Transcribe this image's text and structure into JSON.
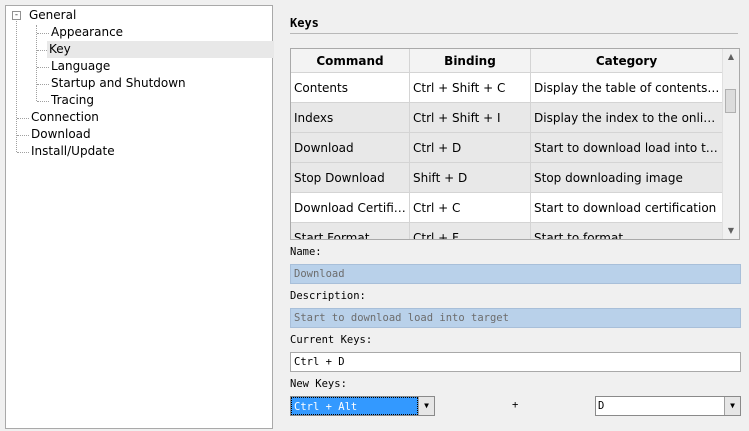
{
  "tree": {
    "items": [
      {
        "label": "General",
        "level": 0,
        "expanded": true
      },
      {
        "label": "Appearance",
        "level": 1
      },
      {
        "label": "Key",
        "level": 1,
        "selected": true
      },
      {
        "label": "Language",
        "level": 1
      },
      {
        "label": "Startup and Shutdown",
        "level": 1
      },
      {
        "label": "Tracing",
        "level": 1
      },
      {
        "label": "Connection",
        "level": 0
      },
      {
        "label": "Download",
        "level": 0
      },
      {
        "label": "Install/Update",
        "level": 0
      }
    ],
    "expander_symbol": "-"
  },
  "section": {
    "title": "Keys"
  },
  "grid": {
    "columns": [
      "Command",
      "Binding",
      "Category"
    ],
    "rows": [
      [
        "Contents",
        "Ctrl + Shift + C",
        "Display the table of contents for help"
      ],
      [
        "Indexs",
        "Ctrl + Shift + I",
        "Display the index to the online help"
      ],
      [
        "Download",
        "Ctrl + D",
        "Start to download load into target"
      ],
      [
        "Stop Download",
        "Shift + D",
        "Stop downloading image"
      ],
      [
        "Download Certification",
        "Ctrl + C",
        "Start to download certification"
      ],
      [
        "Start Format",
        "Ctrl + F",
        "Start to format"
      ]
    ]
  },
  "form": {
    "name_label": "Name:",
    "name_value": "Download",
    "description_label": "Description:",
    "description_value": "Start to download load into target",
    "current_keys_label": "Current Keys:",
    "current_keys_value": "Ctrl + D",
    "new_keys_label": "New Keys:",
    "modifier_value": "Ctrl + Alt",
    "plus": "+",
    "key_value": "D"
  },
  "colors": {
    "readonly_field": "#b9d1ea",
    "selection": "#3399ff"
  }
}
